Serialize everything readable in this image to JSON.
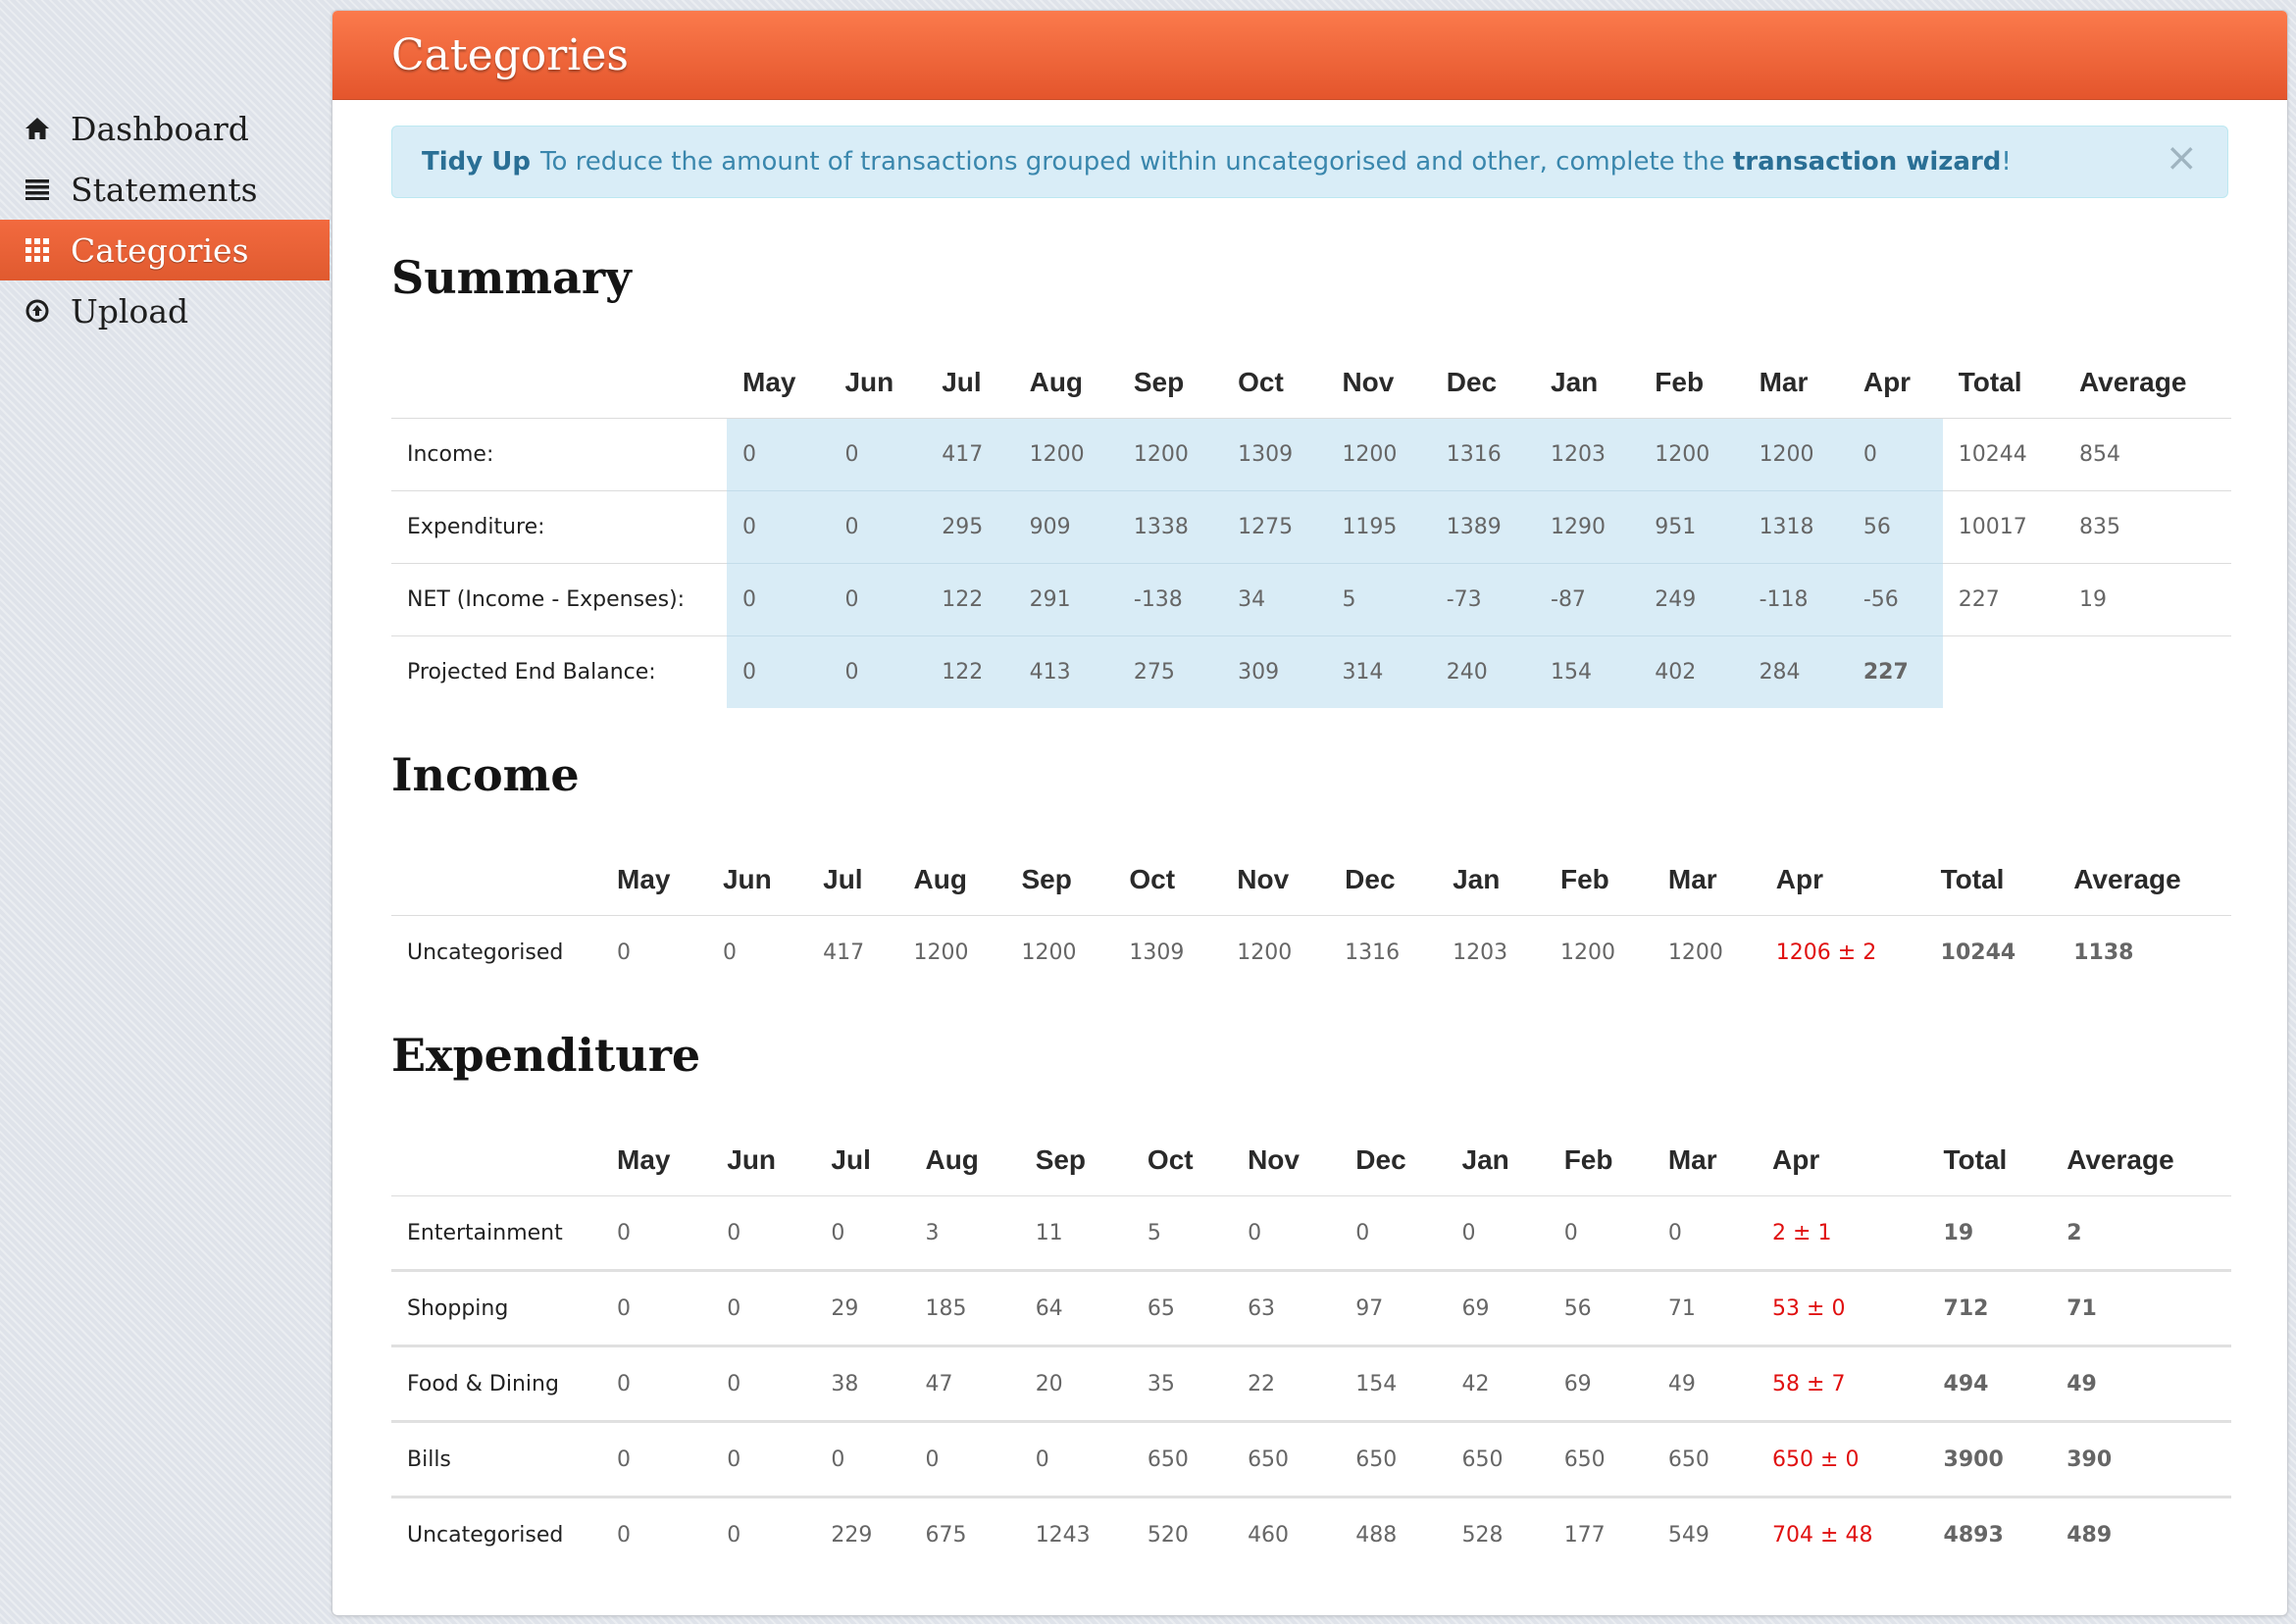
{
  "nav": {
    "items": [
      {
        "label": "Dashboard",
        "icon": "home-icon"
      },
      {
        "label": "Statements",
        "icon": "list-icon"
      },
      {
        "label": "Categories",
        "icon": "grid-icon",
        "active": true
      },
      {
        "label": "Upload",
        "icon": "upload-circle-icon"
      }
    ]
  },
  "page": {
    "title": "Categories"
  },
  "alert": {
    "strong": "Tidy Up",
    "text": "To reduce the amount of transactions grouped within uncategorised and other, complete the",
    "link": "transaction wizard",
    "suffix": "!",
    "close": "×"
  },
  "months": [
    "May",
    "Jun",
    "Jul",
    "Aug",
    "Sep",
    "Oct",
    "Nov",
    "Dec",
    "Jan",
    "Feb",
    "Mar",
    "Apr"
  ],
  "totals_header": {
    "total": "Total",
    "average": "Average"
  },
  "summary": {
    "title": "Summary",
    "rows": [
      {
        "label": "Income:",
        "values": [
          "0",
          "0",
          "417",
          "1200",
          "1200",
          "1309",
          "1200",
          "1316",
          "1203",
          "1200",
          "1200",
          "0"
        ],
        "total": "10244",
        "average": "854"
      },
      {
        "label": "Expenditure:",
        "values": [
          "0",
          "0",
          "295",
          "909",
          "1338",
          "1275",
          "1195",
          "1389",
          "1290",
          "951",
          "1318",
          "56"
        ],
        "total": "10017",
        "average": "835"
      },
      {
        "label": "NET (Income - Expenses):",
        "values": [
          "0",
          "0",
          "122",
          "291",
          "-138",
          "34",
          "5",
          "-73",
          "-87",
          "249",
          "-118",
          "-56"
        ],
        "total": "227",
        "average": "19"
      },
      {
        "label": "Projected End Balance:",
        "values": [
          "0",
          "0",
          "122",
          "413",
          "275",
          "309",
          "314",
          "240",
          "154",
          "402",
          "284",
          "227"
        ],
        "total": "",
        "average": ""
      }
    ]
  },
  "income": {
    "title": "Income",
    "rows": [
      {
        "label": "Uncategorised",
        "values": [
          "0",
          "0",
          "417",
          "1200",
          "1200",
          "1309",
          "1200",
          "1316",
          "1203",
          "1200",
          "1200"
        ],
        "apr": "1206 ± 2",
        "total": "10244",
        "average": "1138"
      }
    ]
  },
  "expenditure": {
    "title": "Expenditure",
    "rows": [
      {
        "label": "Entertainment",
        "values": [
          "0",
          "0",
          "0",
          "3",
          "11",
          "5",
          "0",
          "0",
          "0",
          "0",
          "0"
        ],
        "apr": "2 ± 1",
        "total": "19",
        "average": "2"
      },
      {
        "label": "Shopping",
        "values": [
          "0",
          "0",
          "29",
          "185",
          "64",
          "65",
          "63",
          "97",
          "69",
          "56",
          "71"
        ],
        "apr": "53 ± 0",
        "total": "712",
        "average": "71"
      },
      {
        "label": "Food & Dining",
        "values": [
          "0",
          "0",
          "38",
          "47",
          "20",
          "35",
          "22",
          "154",
          "42",
          "69",
          "49"
        ],
        "apr": "58 ± 7",
        "total": "494",
        "average": "49"
      },
      {
        "label": "Bills",
        "values": [
          "0",
          "0",
          "0",
          "0",
          "0",
          "650",
          "650",
          "650",
          "650",
          "650",
          "650"
        ],
        "apr": "650 ± 0",
        "total": "3900",
        "average": "390"
      },
      {
        "label": "Uncategorised",
        "values": [
          "0",
          "0",
          "229",
          "675",
          "1243",
          "520",
          "460",
          "488",
          "528",
          "177",
          "549"
        ],
        "apr": "704 ± 48",
        "total": "4893",
        "average": "489"
      }
    ]
  }
}
